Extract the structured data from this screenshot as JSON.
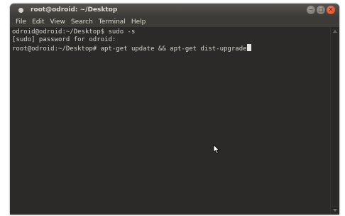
{
  "window": {
    "title": "root@odroid: ~/Desktop"
  },
  "menu": {
    "items": [
      "File",
      "Edit",
      "View",
      "Search",
      "Terminal",
      "Help"
    ]
  },
  "terminal": {
    "lines": [
      "odroid@odroid:~/Desktop$ sudo -s",
      "[sudo] password for odroid:",
      "root@odroid:~/Desktop# apt-get update && apt-get dist-upgrade"
    ]
  },
  "icons": {
    "title": "terminal-icon",
    "minimize": "minimize-icon",
    "maximize": "maximize-icon",
    "close": "close-icon",
    "pointer": "mouse-pointer-icon"
  },
  "colors": {
    "terminal_bg": "#2c2a28",
    "terminal_fg": "#d8d6d0",
    "close_button": "#e0512a"
  }
}
